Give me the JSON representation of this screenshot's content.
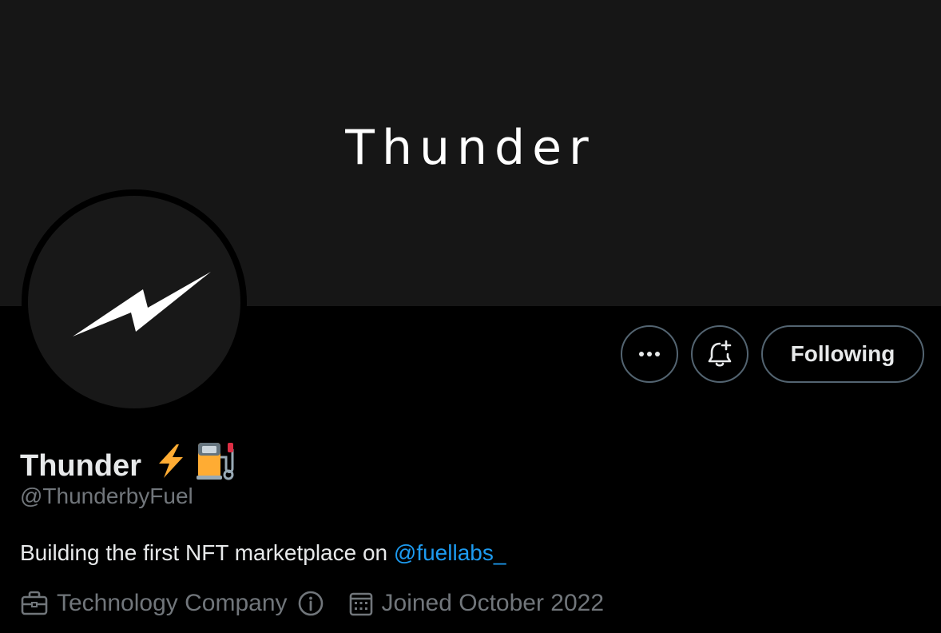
{
  "banner": {
    "title": "Thunder"
  },
  "actions": {
    "more_icon": "more-horizontal-icon",
    "notify_icon": "bell-plus-icon",
    "follow_label": "Following"
  },
  "profile": {
    "display_name": "Thunder",
    "name_emojis": [
      "high-voltage-emoji",
      "fuel-pump-emoji"
    ],
    "handle": "@ThunderbyFuel",
    "bio_text": "Building the first NFT marketplace on ",
    "bio_mention": "@fuellabs_",
    "category": "Technology Company",
    "category_icon": "briefcase-icon",
    "info_icon": "info-icon",
    "joined": "Joined October 2022",
    "joined_icon": "calendar-icon"
  },
  "colors": {
    "background": "#000000",
    "banner": "#161616",
    "text_primary": "#e7e9ea",
    "text_secondary": "#71767b",
    "link": "#1d9bf0",
    "button_border": "#536471"
  }
}
